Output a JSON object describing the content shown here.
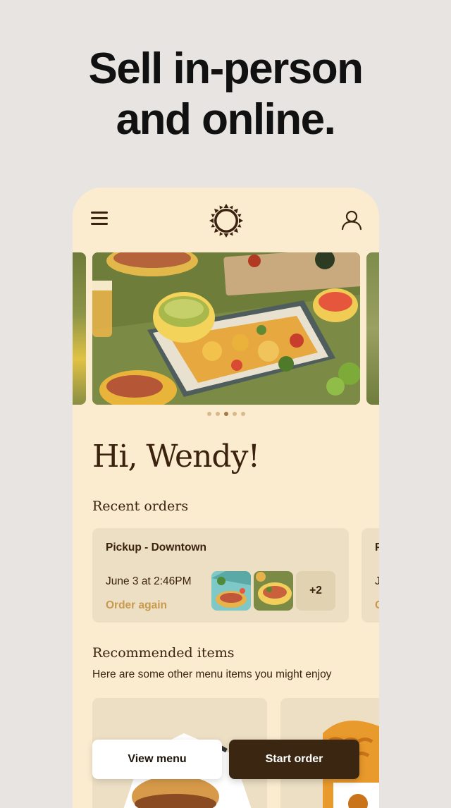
{
  "promo": {
    "headline_line1": "Sell in-person",
    "headline_line2": "and online."
  },
  "header": {
    "menu_icon": "hamburger-menu-icon",
    "logo": "sun-badge-logo",
    "account_icon": "user-icon"
  },
  "carousel": {
    "slide_count": 5,
    "active_index": 2
  },
  "greeting": "Hi, Wendy!",
  "recent_orders": {
    "title": "Recent orders",
    "cards": [
      {
        "title": "Pickup - Downtown",
        "date": "June 3 at 2:46PM",
        "action": "Order again",
        "more_count": "+2"
      },
      {
        "title": "P",
        "date": "J",
        "action": "O"
      }
    ]
  },
  "recommended": {
    "title": "Recommended items",
    "subtitle": "Here are some other menu items you might enjoy"
  },
  "actions": {
    "view_menu": "View menu",
    "start_order": "Start order"
  },
  "colors": {
    "background": "#e7e4e1",
    "app_background": "#fbecd0",
    "primary_brown": "#3b2612",
    "accent_gold": "#c9994c",
    "card": "#ecdfc4"
  }
}
